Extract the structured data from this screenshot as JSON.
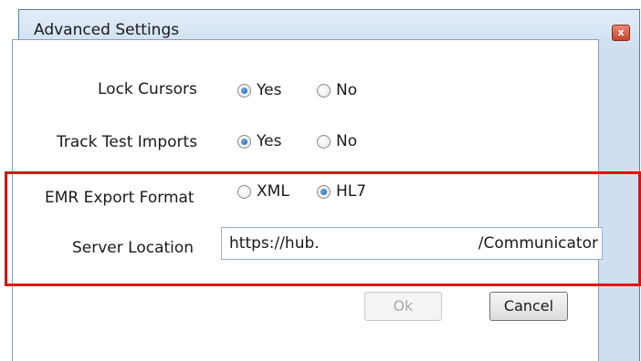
{
  "window": {
    "title": "Advanced Settings",
    "close_icon": "close-icon",
    "close_glyph": "x"
  },
  "settings": {
    "lock_cursors": {
      "label": "Lock Cursors",
      "options": [
        "Yes",
        "No"
      ],
      "selected": "Yes"
    },
    "track_test_imports": {
      "label": "Track Test Imports",
      "options": [
        "Yes",
        "No"
      ],
      "selected": "Yes"
    },
    "emr_export_format": {
      "label": "EMR Export Format",
      "options": [
        "XML",
        "HL7"
      ],
      "selected": "HL7"
    },
    "server_location": {
      "label": "Server Location",
      "value_start": "https://hub.",
      "value_end": "/Communicator"
    }
  },
  "buttons": {
    "ok": "Ok",
    "cancel": "Cancel"
  },
  "colors": {
    "highlight": "#e01010",
    "title_bar": "#cfdff1",
    "close_button": "#c7422a"
  }
}
